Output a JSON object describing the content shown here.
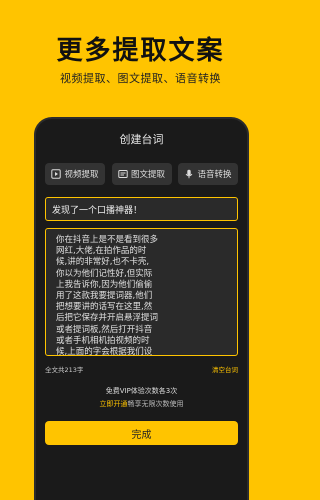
{
  "header": {
    "title": "更多提取文案",
    "subtitle": "视频提取、图文提取、语音转换"
  },
  "screen": {
    "title": "创建台词",
    "tabs": [
      {
        "label": "视频提取",
        "icon": "video-icon"
      },
      {
        "label": "图文提取",
        "icon": "image-text-icon"
      },
      {
        "label": "语音转换",
        "icon": "microphone-icon"
      }
    ],
    "title_input_value": "发现了一个口播神器！",
    "script_text": "你在抖音上是不是看到很多\n网红,大佬,在拍作品的时\n候,讲的非常好,也不卡壳,\n你以为他们记性好,但实际\n上我告诉你,因为他们偷偷\n用了这款我要提词器,他们\n把想要讲的话写在这里,然\n后把它保存并开启悬浮提词\n或者提词板,然后打开抖音\n或者手机相机拍视频的时\n候,上面的字会根据我们设",
    "word_count": "全文共213字",
    "clear_label": "清空台词",
    "quota_text": "免费VIP体验次数各3次",
    "upsell_link": "立即开通",
    "upsell_text": "畅享无限次数使用",
    "done_label": "完成"
  },
  "colors": {
    "accent": "#FFC400",
    "phone_bg": "#1a1a1a"
  }
}
